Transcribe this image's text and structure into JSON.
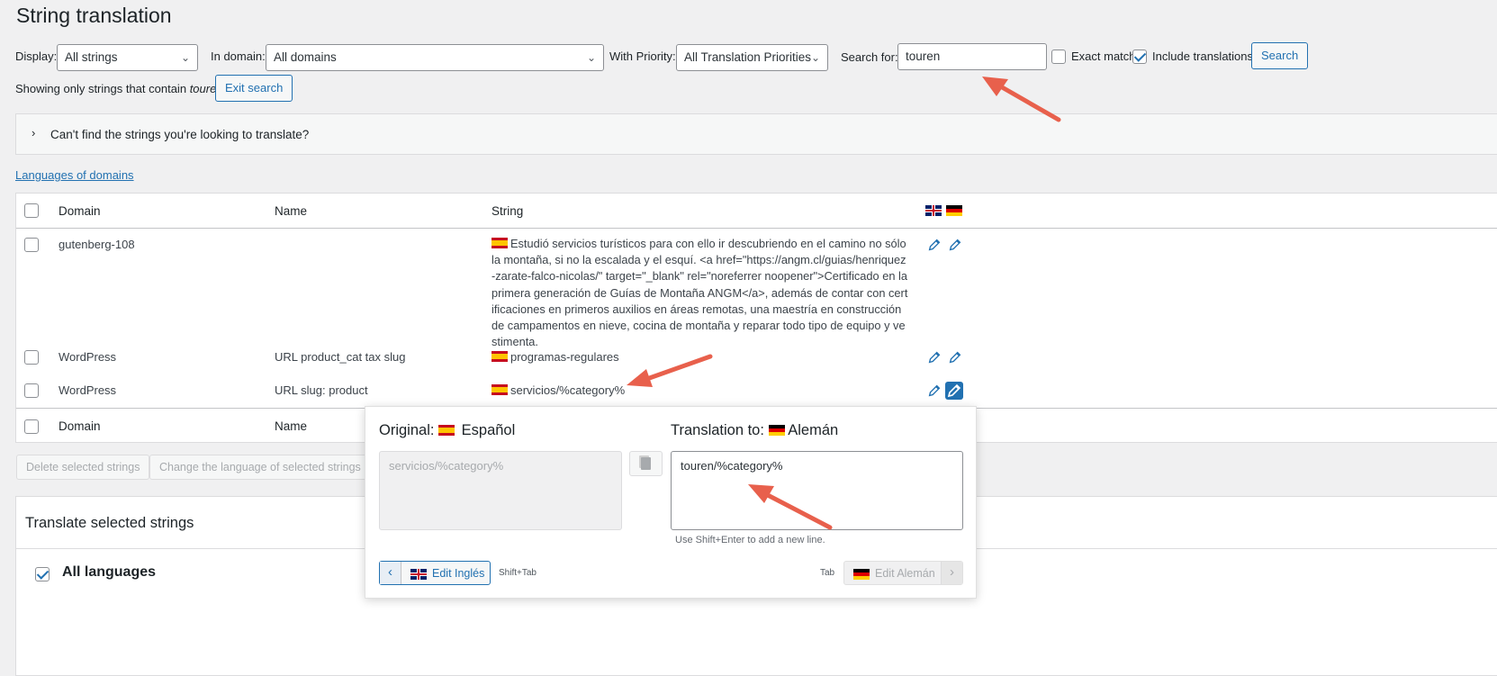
{
  "page": {
    "title": "String translation"
  },
  "filters": {
    "display_label": "Display:",
    "display_value": "All strings",
    "domain_label": "In domain:",
    "domain_value": "All domains",
    "priority_label": "With Priority:",
    "priority_value": "All Translation Priorities",
    "search_label": "Search for:",
    "search_value": "touren",
    "exact_match_label": "Exact match",
    "exact_match_checked": false,
    "include_translations_label": "Include translations",
    "include_translations_checked": true,
    "search_button": "Search"
  },
  "search_info": {
    "prefix": "Showing only strings that contain",
    "term": "touren",
    "exit_button": "Exit search"
  },
  "cant_find": {
    "text": "Can't find the strings you're looking to translate?"
  },
  "languages_link": "Languages of domains",
  "table": {
    "headers": {
      "domain": "Domain",
      "name": "Name",
      "string": "String"
    },
    "header_flags": [
      "uk-flag",
      "de-flag"
    ],
    "rows": [
      {
        "domain": "gutenberg-108",
        "name": "",
        "string": "Estudió servicios turísticos para con ello ir descubriendo en el camino no sólo la montaña, si no la escalada y el esquí. <a href=\"https://angm.cl/guias/henriquez-zarate-falco-nicolas/\" target=\"_blank\" rel=\"noreferrer noopener\">Certificado en la primera generación de Guías de Montaña ANGM</a>, además de contar con certificaciones en primeros auxilios en áreas remotas, una maestría en construcción de campamentos en nieve, cocina de montaña y reparar todo tipo de equipo y vestimenta."
      },
      {
        "domain": "WordPress",
        "name": "URL product_cat tax slug",
        "string": "programas-regulares"
      },
      {
        "domain": "WordPress",
        "name": "URL slug: product",
        "string": "servicios/%category%"
      }
    ],
    "footer": {
      "domain": "Domain",
      "name": "Name"
    }
  },
  "bulk": {
    "delete_button": "Delete selected strings",
    "change_language_button": "Change the language of selected strings"
  },
  "translate_section": {
    "title": "Translate selected strings",
    "all_languages_label": "All languages",
    "all_languages_checked": true
  },
  "popup": {
    "original_label": "Original:",
    "original_language": "Español",
    "original_value": "servicios/%category%",
    "translation_label": "Translation to:",
    "translation_language": "Alemán",
    "translation_value": "touren/%category%",
    "hint": "Use Shift+Enter to add a new line.",
    "prev_button": "Edit Inglés",
    "prev_shortcut": "Shift+Tab",
    "next_shortcut": "Tab",
    "next_button": "Edit Alemán"
  },
  "colors": {
    "accent": "#2271b1",
    "arrow": "#e8604c",
    "background": "#f0f0f1"
  }
}
